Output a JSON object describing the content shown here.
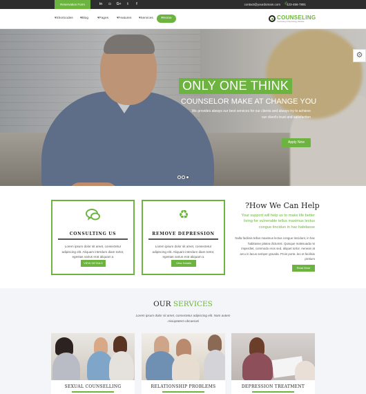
{
  "topbar": {
    "reservation_label": "Reservation Form",
    "social_icons": [
      "linkedin-icon",
      "instagram-icon",
      "google-plus-icon",
      "twitter-icon",
      "facebook-icon"
    ],
    "social_glyphs": [
      "in",
      "◘",
      "G+",
      "t",
      "f"
    ],
    "email": "contact@yourdomain.com",
    "phone": "123-456-7891"
  },
  "nav": {
    "items": [
      "Shortcodes",
      "Blog",
      "Pages",
      "Features",
      "Services"
    ],
    "home_label": "Home",
    "logo_text_dark": "C",
    "logo_text_green": "COUNSELING",
    "logo_tagline": "Counseling & Psychology Website"
  },
  "hero": {
    "title": "ONLY ONE THINK",
    "subtitle": "COUNSELOR MAKE AT CHANGE YOU",
    "description": "We provides always our best services for our clients and always try to achieve our client's trust and satisfaction",
    "button_label": "Apply Now",
    "slide_count": 3,
    "active_slide": 3
  },
  "features": [
    {
      "icon": "chat-bubbles-icon",
      "title": "CONSULTING US",
      "text": "Lorem ipsum dolor sit amet, consectetur adipiscing elit. Aliquam interdum diam tortor, egestas varius erat aliquam a",
      "button_label": "VIEW DETAILS"
    },
    {
      "icon": "recycle-icon",
      "title": "REMOVE DEPRESSION",
      "text": "Lorem ipsum dolor sit amet, consectetur adipiscing elit. Aliquam interdum diam tortor, egestas varius erat aliquam a",
      "button_label": "View Details"
    }
  ],
  "help": {
    "title": "?How We Can Help",
    "lead": "Your support will help us to make life better living for vulnerable tellus maximus lectus congue tincidun in hac habitasse",
    "body": "Nulla facilisis tellus maximus lectus congue tincidunt, in hac habitasse platea dictumst. Quisque malesuada mi imperdiet, commodo eros sed, aliquet tortor. Aenean at arcu in lacus semper gravida. Proin porta .leo et facilisis pretium",
    "button_label": "Read More"
  },
  "services": {
    "title_dark": "OUR",
    "title_green": "SERVICES",
    "description": "Lorem ipsum dolor sit amet, consectetur adipiscing elit. Nam autem .nisiuptatem obcaecati",
    "items": [
      {
        "label": "SEXUAL COUNSELLING"
      },
      {
        "label": "RELATIONSHIP PROBLEMS"
      },
      {
        "label": "DEPRESSION TREATMENT"
      }
    ]
  },
  "colors": {
    "accent": "#6cb33f",
    "topbar": "#2e2e2e",
    "services_bg": "#f4f5f8"
  }
}
